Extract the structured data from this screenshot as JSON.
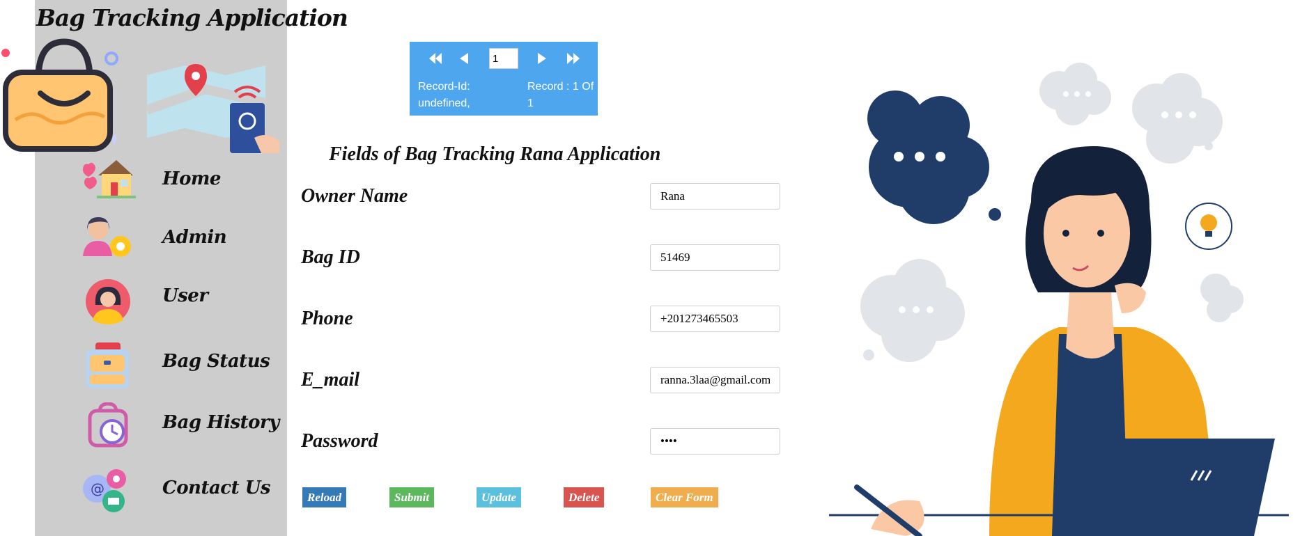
{
  "app": {
    "title": "Bag Tracking Application"
  },
  "nav": {
    "items": [
      {
        "label": "Home",
        "icon": "house-heart-icon"
      },
      {
        "label": "Admin",
        "icon": "admin-gear-icon"
      },
      {
        "label": "User",
        "icon": "user-avatar-icon"
      },
      {
        "label": "Bag Status",
        "icon": "backpack-icon"
      },
      {
        "label": "Bag History",
        "icon": "bag-clock-icon"
      },
      {
        "label": "Contact Us",
        "icon": "contact-bubbles-icon"
      }
    ]
  },
  "pager": {
    "current_page": "1",
    "record_id_line1": "Record-Id:",
    "record_id_line2": "undefined,",
    "record_count_line1": "Record : 1 Of",
    "record_count_line2": "1",
    "color": "#4ea6ee"
  },
  "form": {
    "title": "Fields of Bag Tracking Rana Application",
    "fields": [
      {
        "label": "Owner Name",
        "value": "Rana"
      },
      {
        "label": "Bag ID",
        "value": "51469"
      },
      {
        "label": "Phone",
        "value": "+201273465503"
      },
      {
        "label": "E_mail",
        "value": "ranna.3laa@gmail.com"
      },
      {
        "label": "Password",
        "value": "1234"
      }
    ]
  },
  "buttons": {
    "reload": "Reload",
    "submit": "Submit",
    "update": "Update",
    "delete": "Delete",
    "clear": "Clear Form"
  },
  "colors": {
    "sidebar": "#cdcdcd",
    "reload": "#337ab7",
    "submit": "#5cb85c",
    "update": "#5bc0de",
    "delete": "#d9534f",
    "clear": "#f0ad4e"
  }
}
